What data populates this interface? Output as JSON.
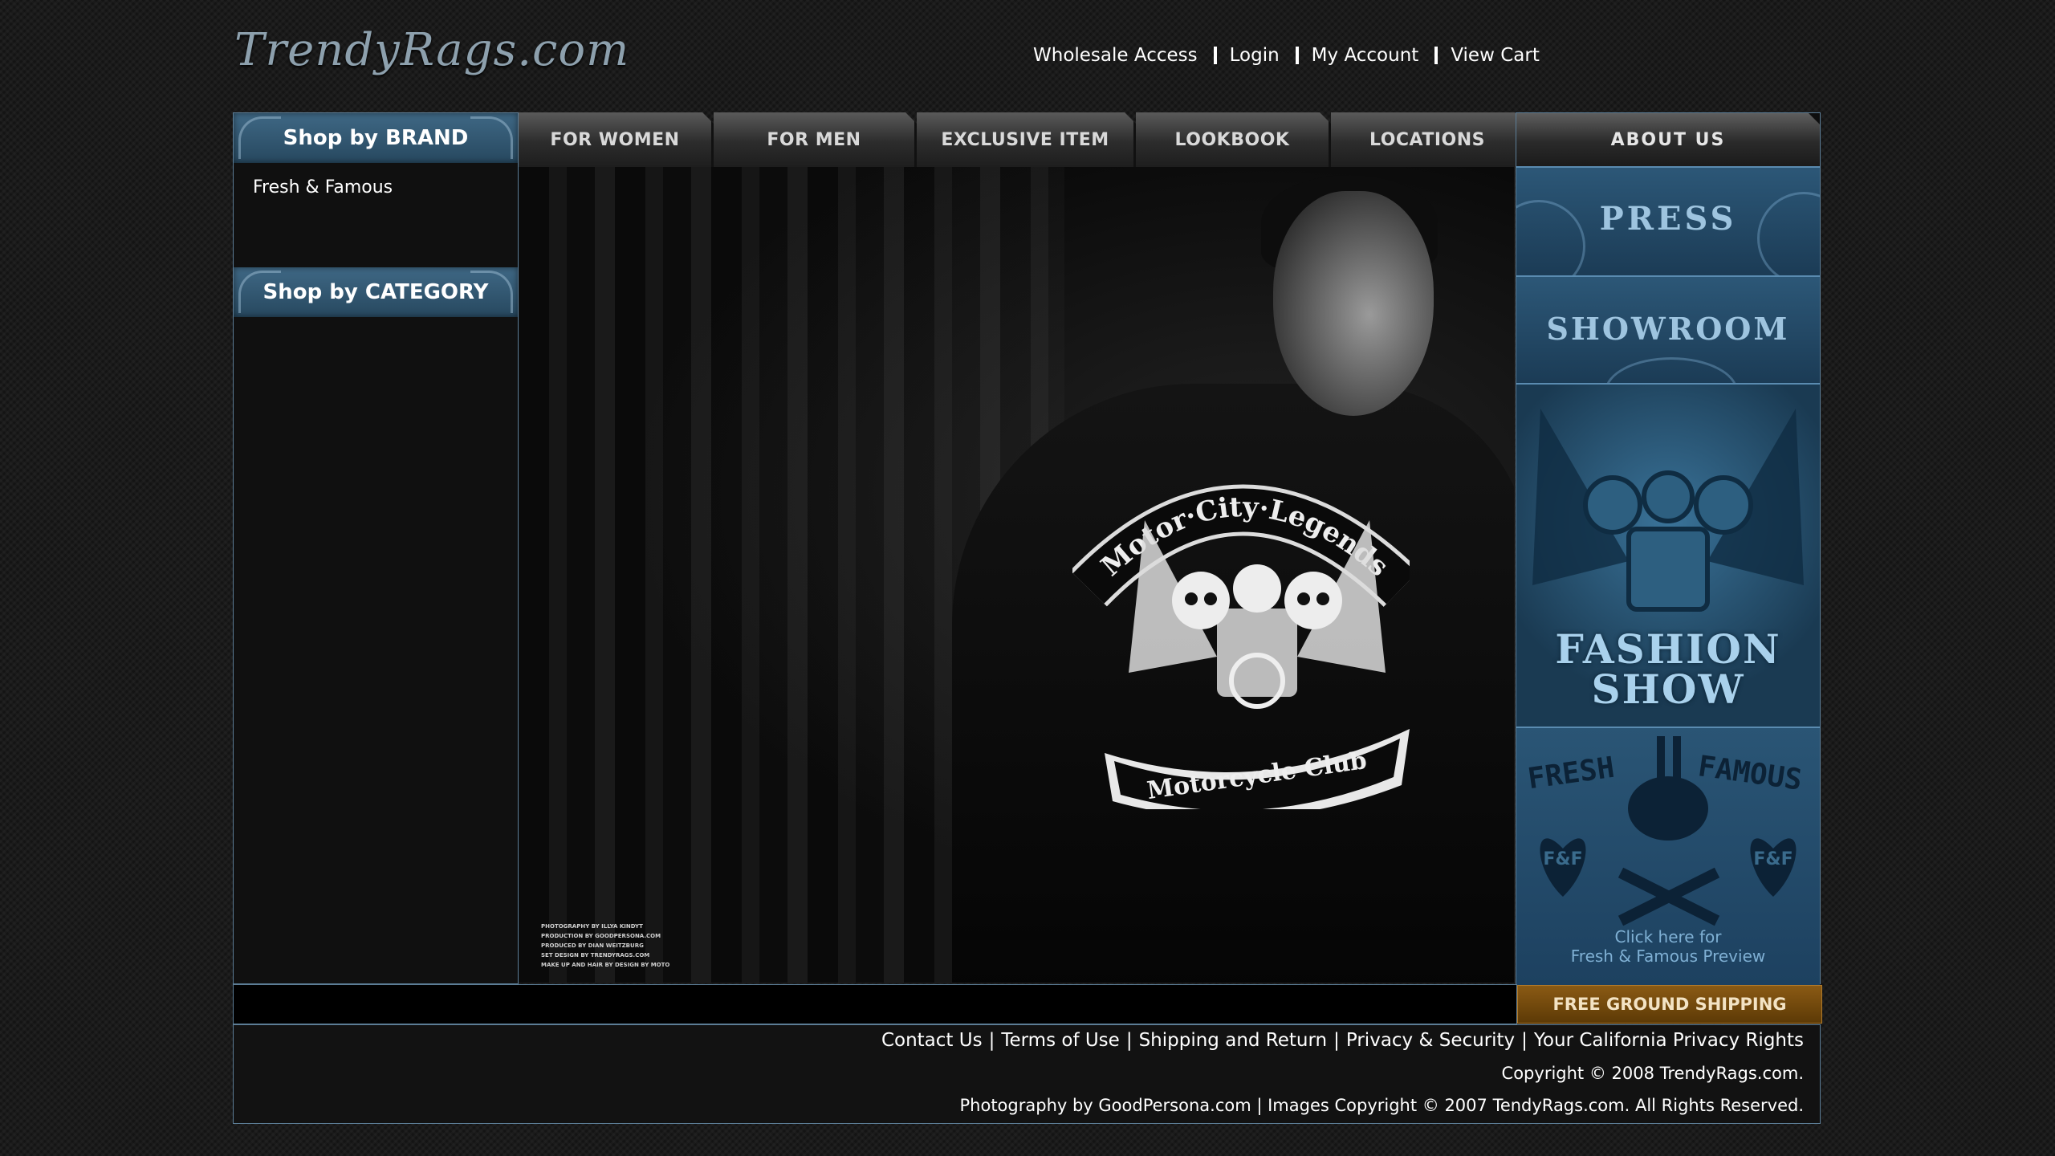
{
  "header": {
    "logo_text": "TrendyRags.com",
    "top_links": [
      "Wholesale Access",
      "Login",
      "My Account",
      "View Cart"
    ]
  },
  "sidebar": {
    "brand_heading": "Shop by BRAND",
    "brand_items": [
      "Fresh & Famous"
    ],
    "category_heading": "Shop by CATEGORY"
  },
  "mainnav": {
    "tabs": [
      "FOR WOMEN",
      "FOR MEN",
      "EXCLUSIVE ITEM",
      "LOOKBOOK",
      "LOCATIONS"
    ]
  },
  "hero": {
    "patch_top": "Motor·City·Legends",
    "patch_bottom": "Motorcycle Club",
    "credits": [
      "PHOTOGRAPHY BY ILLYA KINDYT",
      "PRODUCTION BY GOODPERSONA.COM",
      "PRODUCED BY DIAN WEITZBURG",
      "SET DESIGN BY TRENDYRAGS.COM",
      "MAKE UP AND HAIR BY DESIGN BY MOTO"
    ]
  },
  "rightcol": {
    "about_label": "ABOUT US",
    "press_label": "PRESS",
    "showroom_label": "SHOWROOM",
    "fashion_show_line1": "FASHION",
    "fashion_show_line2": "SHOW",
    "ff_brand_left": "FRESH",
    "ff_brand_right": "FAMOUS",
    "ff_heart": "F&F",
    "ff_caption_line1": "Click here for",
    "ff_caption_line2": "Fresh & Famous Preview"
  },
  "shipping_label": "FREE GROUND SHIPPING",
  "footer": {
    "links": [
      "Contact Us",
      "Terms of Use",
      "Shipping and Return",
      "Privacy & Security",
      "Your California Privacy Rights"
    ],
    "copyright": "Copyright © 2008 TrendyRags.com.",
    "photo_credit": "Photography by GoodPersona.com | Images Copyright © 2007 TendyRags.com. All Rights Reserved."
  }
}
